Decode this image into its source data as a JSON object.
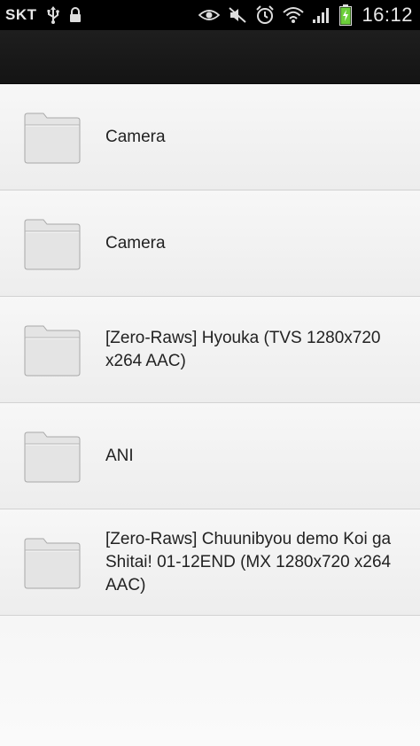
{
  "status_bar": {
    "carrier": "SKT",
    "time": "16:12",
    "icons": [
      "usb-icon",
      "lock-icon",
      "eye-icon",
      "mute-icon",
      "alarm-icon",
      "wifi-icon",
      "signal-icon",
      "battery-charging-icon"
    ]
  },
  "folders": [
    {
      "name": "Camera"
    },
    {
      "name": "Camera"
    },
    {
      "name": "[Zero-Raws] Hyouka (TVS 1280x720 x264 AAC)"
    },
    {
      "name": "ANI"
    },
    {
      "name": "[Zero-Raws] Chuunibyou demo Koi ga Shitai! 01-12END (MX 1280x720 x264 AAC)"
    }
  ]
}
